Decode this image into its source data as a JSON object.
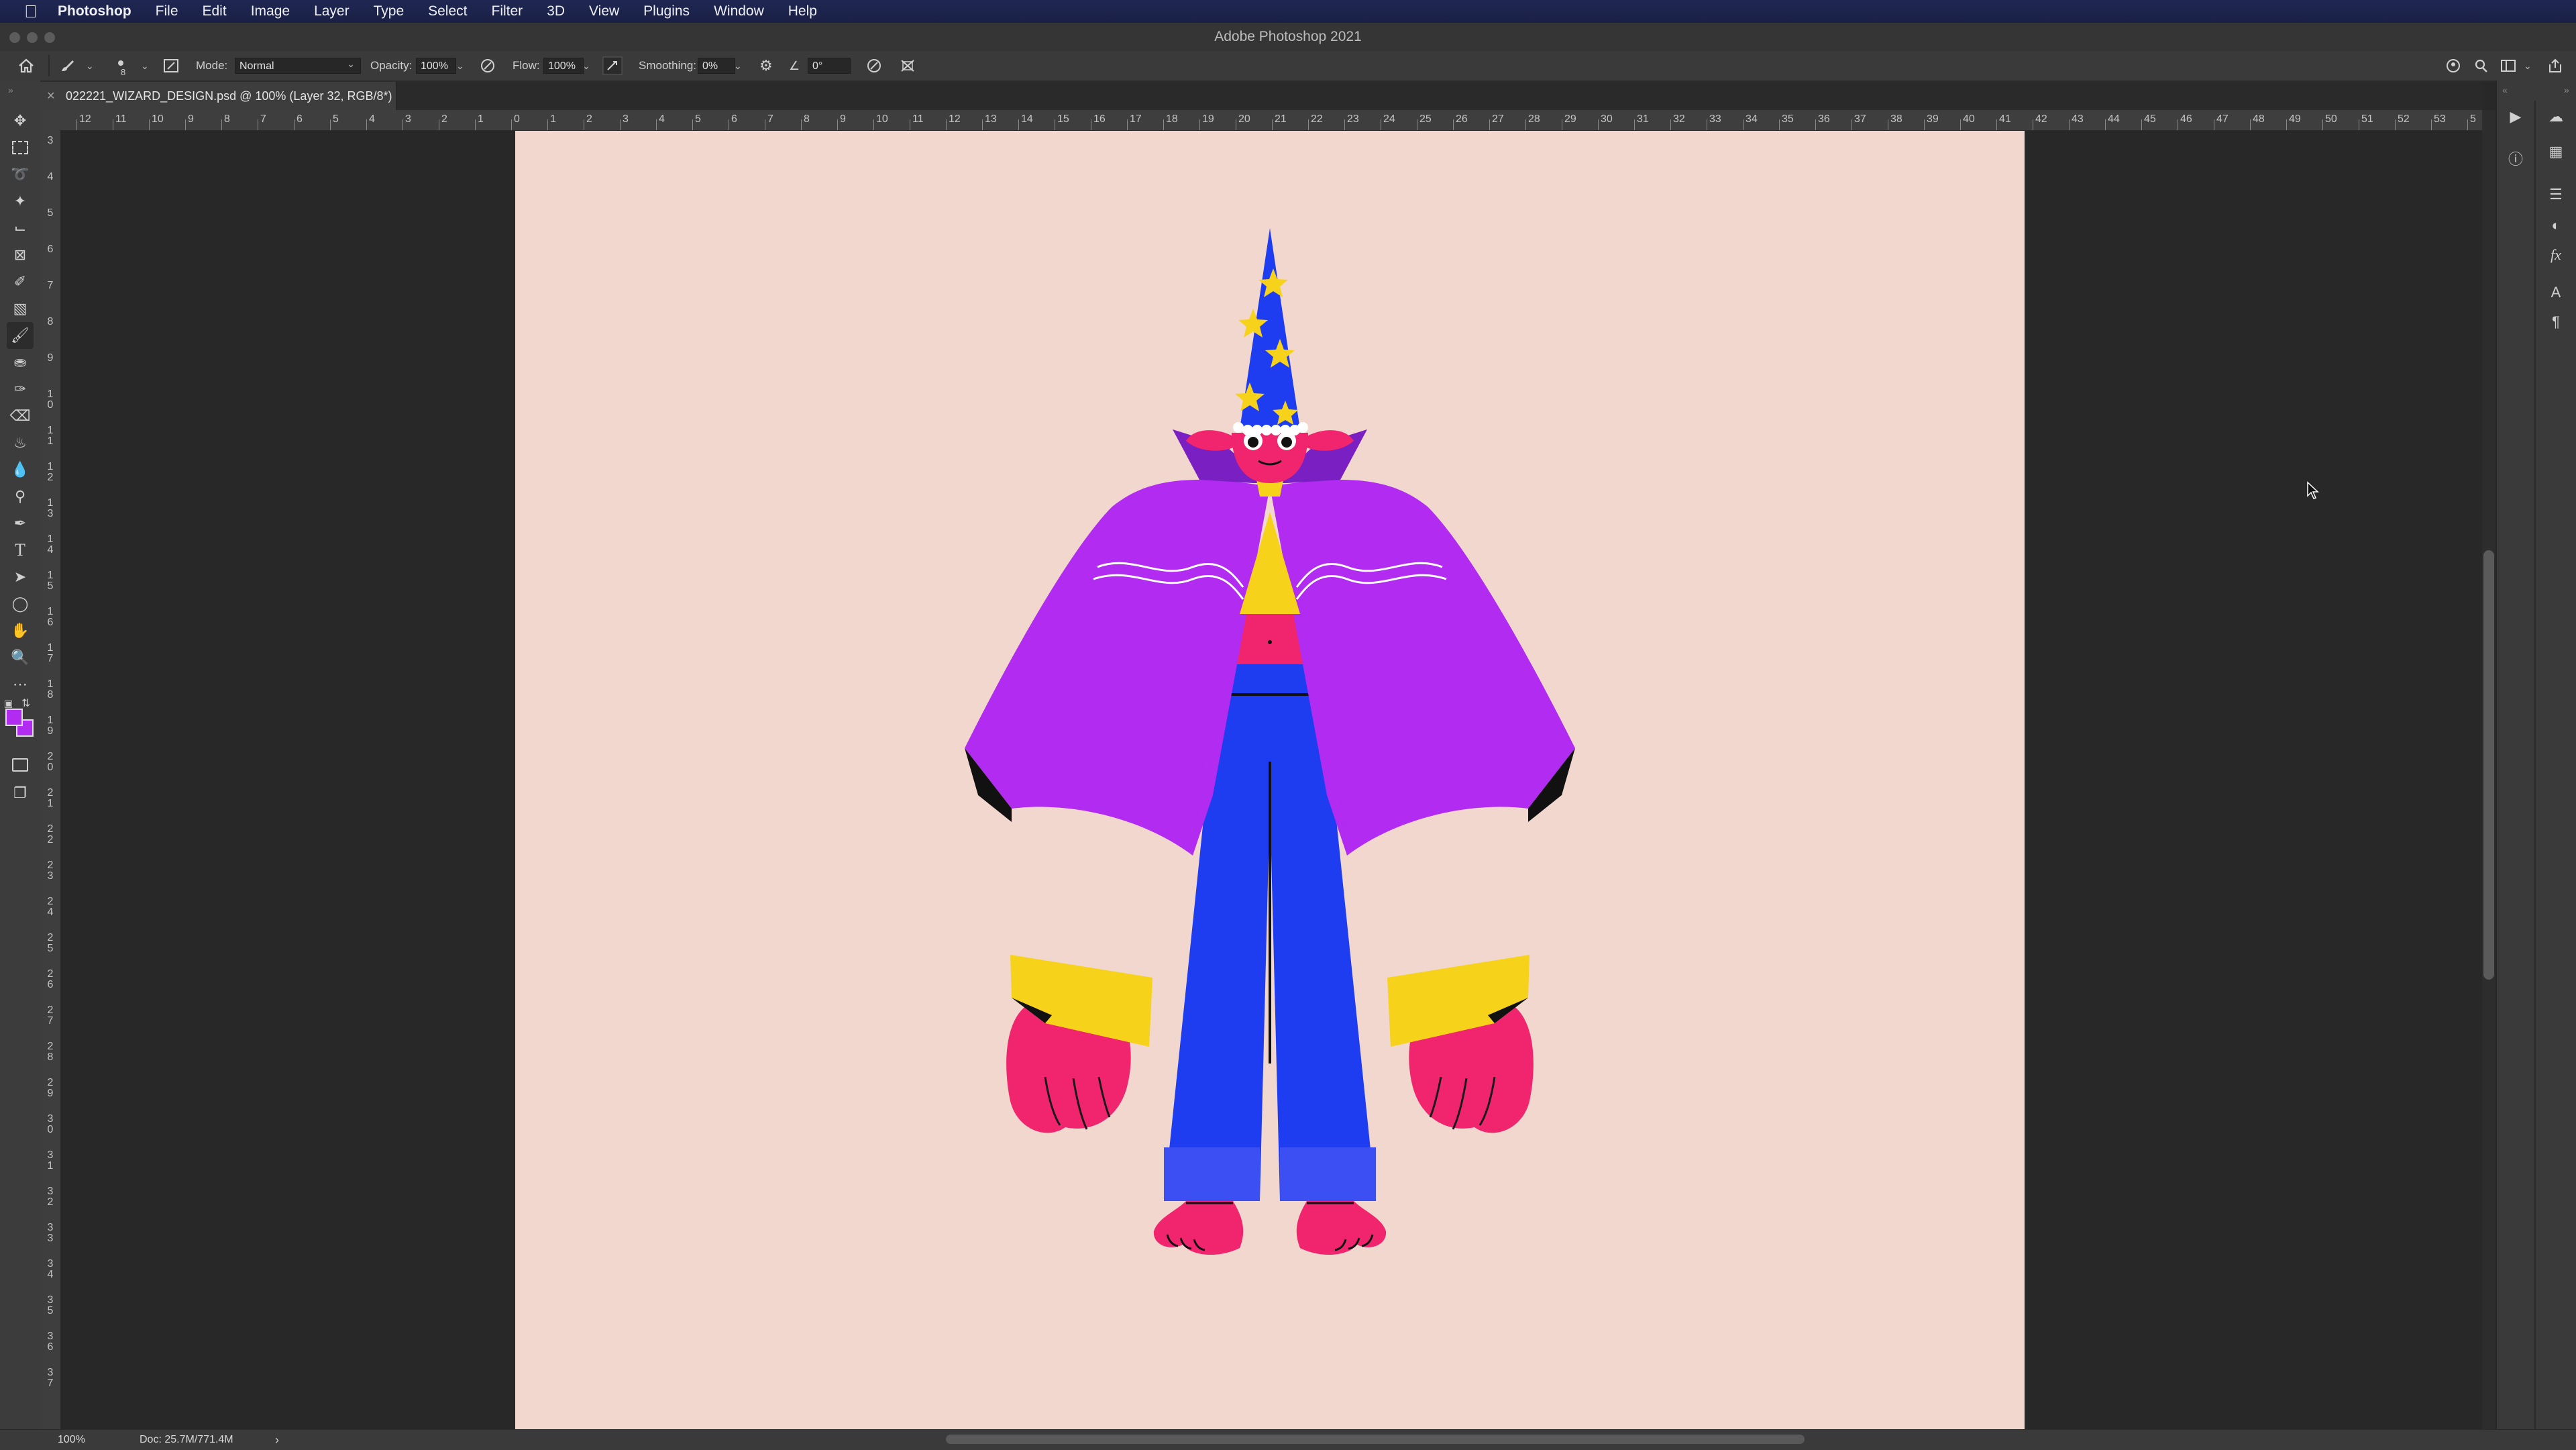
{
  "menubar": {
    "items": [
      "Photoshop",
      "File",
      "Edit",
      "Image",
      "Layer",
      "Type",
      "Select",
      "Filter",
      "3D",
      "View",
      "Plugins",
      "Window",
      "Help"
    ]
  },
  "window": {
    "title": "Adobe Photoshop 2021"
  },
  "options": {
    "mode_label": "Mode:",
    "mode_value": "Normal",
    "opacity_label": "Opacity:",
    "opacity_value": "100%",
    "flow_label": "Flow:",
    "flow_value": "100%",
    "smoothing_label": "Smoothing:",
    "smoothing_value": "0%",
    "angle_value": "0°"
  },
  "document": {
    "tab_title": "022221_WIZARD_DESIGN.psd @ 100% (Layer 32, RGB/8*)",
    "close_glyph": "×"
  },
  "status": {
    "zoom": "100%",
    "doc_size": "Doc: 25.7M/771.4M",
    "arrow": "›"
  },
  "rulers": {
    "h_labels": [
      "12",
      "11",
      "10",
      "9",
      "8",
      "7",
      "6",
      "5",
      "4",
      "3",
      "2",
      "1",
      "0",
      "1",
      "2",
      "3",
      "4",
      "5",
      "6",
      "7",
      "8",
      "9",
      "10",
      "11",
      "12",
      "13",
      "14",
      "15",
      "16",
      "17",
      "18",
      "19",
      "20",
      "21",
      "22",
      "23",
      "24",
      "25",
      "26",
      "27",
      "28",
      "29",
      "30",
      "31",
      "32",
      "33",
      "34",
      "35",
      "36",
      "37",
      "38",
      "39",
      "40",
      "41",
      "42",
      "43",
      "44",
      "45",
      "46",
      "47",
      "48",
      "49",
      "50",
      "51",
      "52",
      "53",
      "5"
    ],
    "v_labels": [
      "3",
      "4",
      "5",
      "6",
      "7",
      "8",
      "9",
      "1 0",
      "1 1",
      "1 2",
      "1 3",
      "1 4",
      "1 5",
      "1 6",
      "1 7",
      "1 8",
      "1 9",
      "2 0",
      "2 1",
      "2 2",
      "2 3",
      "2 4",
      "2 5",
      "2 6",
      "2 7",
      "2 8",
      "2 9",
      "3 0",
      "3 1",
      "3 2",
      "3 3",
      "3 4",
      "3 5",
      "3 6",
      "3 7"
    ]
  },
  "colors": {
    "foreground": "#b12bf0",
    "background": "#b12bf0",
    "canvas": "#f2d7ce",
    "cape": "#b12bf0",
    "pants": "#1f3df0",
    "skin": "#f0256e",
    "yellow": "#f7d21a"
  },
  "icons": {
    "tools": [
      "move-icon",
      "marquee-icon",
      "lasso-icon",
      "magic-wand-icon",
      "crop-icon",
      "frame-icon",
      "eyedropper-icon",
      "healing-brush-icon",
      "brush-icon",
      "clone-stamp-icon",
      "history-brush-icon",
      "eraser-icon",
      "paint-bucket-icon",
      "blur-icon",
      "dodge-icon",
      "pen-icon",
      "type-icon",
      "path-selection-icon",
      "ellipse-icon",
      "hand-icon",
      "zoom-icon",
      "more-tools-icon"
    ]
  }
}
